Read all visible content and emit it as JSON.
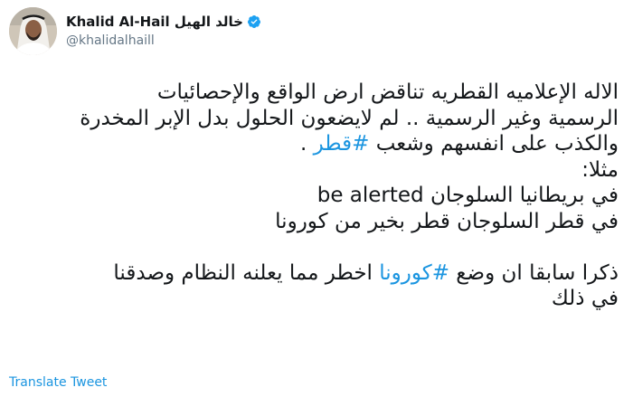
{
  "author": {
    "display_name": "Khalid Al-Hail خالد الهيل",
    "handle": "@khalidalhaill",
    "verified_icon": "verified-badge-icon",
    "verified_color": "#1da1f2"
  },
  "tweet": {
    "line1": "الاله الإعلاميه القطريه تناقض ارض الواقع والإحصائيات",
    "line2": "الرسمية وغير الرسمية .. لم لايضعون الحلول بدل الإبر المخدرة",
    "line3_text": "والكذب على انفسهم وشعب ",
    "line3_hashtag": "#قطر",
    "line3_end": " .",
    "line4": "مثلا:",
    "line5_arabic": "في بريطانيا السلوجان ",
    "line5_english": "be alerted",
    "line6": "في قطر السلوجان قطر بخير من كورونا",
    "line7_text_before": "ذكرا سابقا ان وضع ",
    "line7_hashtag": "#كورونا",
    "line7_text_after": " اخطر مما يعلنه النظام وصدقنا",
    "line8": "في ذلك",
    "hashtag_color": "#1b95e0"
  },
  "footer": {
    "translate_label": "Translate Tweet"
  }
}
